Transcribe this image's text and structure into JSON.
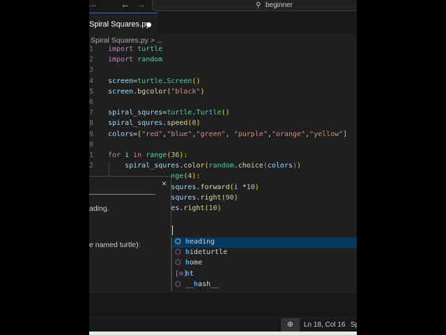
{
  "titlebar": {
    "more": "…",
    "back": "←",
    "forward": "→",
    "search_icon": "search-icon",
    "search_text": "beginner"
  },
  "tab": {
    "label": "Spiral Squares.py"
  },
  "breadcrumb": "Spiral Squares.py > ...",
  "code": [
    {
      "g": "1",
      "col": 0,
      "t": [
        [
          "import ",
          "kw"
        ],
        [
          "turtle",
          "md"
        ]
      ]
    },
    {
      "g": "2",
      "col": 0,
      "t": [
        [
          "import ",
          "kw"
        ],
        [
          "random",
          "md"
        ]
      ]
    },
    {
      "g": "3",
      "col": 0,
      "t": []
    },
    {
      "g": "4",
      "col": 0,
      "t": [
        [
          "screen",
          "vr"
        ],
        [
          "=",
          "pl"
        ],
        [
          "turtle",
          "md"
        ],
        [
          ".",
          "pl"
        ],
        [
          "Screen",
          "md"
        ],
        [
          "()",
          "br"
        ]
      ]
    },
    {
      "g": "5",
      "col": 0,
      "t": [
        [
          "screen",
          "vr"
        ],
        [
          ".",
          "pl"
        ],
        [
          "bgcolor",
          "fn"
        ],
        [
          "(",
          "br"
        ],
        [
          "\"black\"",
          "st"
        ],
        [
          ")",
          "br"
        ]
      ]
    },
    {
      "g": "6",
      "col": 0,
      "t": []
    },
    {
      "g": "7",
      "col": 0,
      "t": [
        [
          "spiral_squres",
          "vr"
        ],
        [
          "=",
          "pl"
        ],
        [
          "turtle",
          "md"
        ],
        [
          ".",
          "pl"
        ],
        [
          "Turtle",
          "md"
        ],
        [
          "()",
          "br"
        ]
      ]
    },
    {
      "g": "8",
      "col": 0,
      "t": [
        [
          "spiral_squres",
          "vr"
        ],
        [
          ".",
          "pl"
        ],
        [
          "speed",
          "fn"
        ],
        [
          "(",
          "br"
        ],
        [
          "0",
          "nm"
        ],
        [
          ")",
          "br"
        ]
      ]
    },
    {
      "g": "9",
      "col": 0,
      "t": [
        [
          "colors",
          "vr"
        ],
        [
          "=",
          "pl"
        ],
        [
          "[",
          "br"
        ],
        [
          "\"red\"",
          "st"
        ],
        [
          ",",
          "pl"
        ],
        [
          "\"blue\"",
          "st"
        ],
        [
          ",",
          "pl"
        ],
        [
          "\"green\"",
          "st"
        ],
        [
          ", ",
          "pl"
        ],
        [
          "\"purple\"",
          "st"
        ],
        [
          ",",
          "pl"
        ],
        [
          "\"orange\"",
          "st"
        ],
        [
          ",",
          "pl"
        ],
        [
          "\"yellow\"",
          "st"
        ],
        [
          "]",
          "br"
        ]
      ]
    },
    {
      "g": "0",
      "col": 0,
      "t": []
    },
    {
      "g": "1",
      "col": 0,
      "t": [
        [
          "for ",
          "kw"
        ],
        [
          "i ",
          "vr"
        ],
        [
          "in ",
          "kw"
        ],
        [
          "range",
          "md"
        ],
        [
          "(",
          "br"
        ],
        [
          "36",
          "nm"
        ],
        [
          "):",
          "br"
        ]
      ]
    },
    {
      "g": "2",
      "col": 4,
      "t": [
        [
          "spiral_squres",
          "vr"
        ],
        [
          ".",
          "pl"
        ],
        [
          "color",
          "fn"
        ],
        [
          "(",
          "br"
        ],
        [
          "random",
          "md"
        ],
        [
          ".",
          "pl"
        ],
        [
          "choice",
          "fn"
        ],
        [
          "(",
          "br2"
        ],
        [
          "colors",
          "vr"
        ],
        [
          ")",
          "br2"
        ],
        [
          ")",
          "br"
        ]
      ]
    },
    {
      "g": "",
      "col": 15,
      "t": [
        [
          "nge",
          "md"
        ],
        [
          "(",
          "br"
        ],
        [
          "4",
          "nm"
        ],
        [
          "):",
          "br"
        ]
      ]
    },
    {
      "g": "",
      "col": 15,
      "t": [
        [
          "squres",
          "vr"
        ],
        [
          ".",
          "pl"
        ],
        [
          "forward",
          "fn"
        ],
        [
          "(",
          "br"
        ],
        [
          "i ",
          "vr"
        ],
        [
          "*",
          "pl"
        ],
        [
          "10",
          "nm"
        ],
        [
          ")",
          "br"
        ]
      ]
    },
    {
      "g": "",
      "col": 15,
      "t": [
        [
          "squres",
          "vr"
        ],
        [
          ".",
          "pl"
        ],
        [
          "right",
          "fn"
        ],
        [
          "(",
          "br"
        ],
        [
          "90",
          "nm"
        ],
        [
          ")",
          "br"
        ]
      ]
    },
    {
      "g": "",
      "col": 15,
      "t": [
        [
          "es",
          "vr"
        ],
        [
          ".",
          "pl"
        ],
        [
          "right",
          "fn"
        ],
        [
          "(",
          "br"
        ],
        [
          "10",
          "nm"
        ],
        [
          ")",
          "br"
        ]
      ]
    }
  ],
  "hover": {
    "close": "×",
    "line1": "ading.",
    "line2": "e named turtle):"
  },
  "suggestions": [
    {
      "icon": "⬡",
      "m": "h",
      "rest": "eading",
      "selected": true
    },
    {
      "icon": "⬡",
      "m": "h",
      "rest": "ideturtle",
      "selected": false
    },
    {
      "icon": "⬡",
      "m": "h",
      "rest": "ome",
      "selected": false
    },
    {
      "icon": "[⊘]",
      "m": "h",
      "rest": "t",
      "selected": false
    },
    {
      "icon": "⬡",
      "pre": "__",
      "m": "h",
      "rest": "ash__",
      "selected": false
    }
  ],
  "status": {
    "zoom_icon": "⊕",
    "position": "Ln 18, Col 16",
    "spaces": "Sp"
  }
}
